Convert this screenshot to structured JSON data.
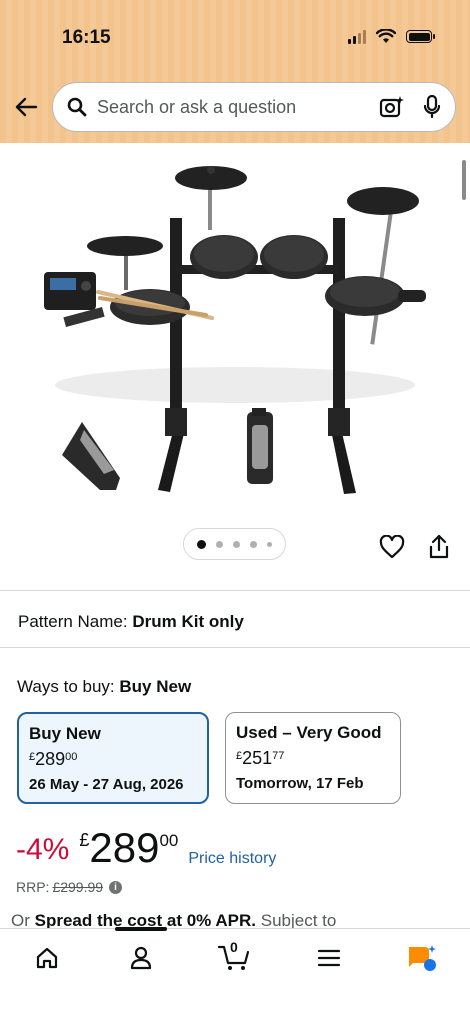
{
  "status_bar": {
    "time": "16:15"
  },
  "search": {
    "placeholder": "Search or ask a question"
  },
  "pattern": {
    "label": "Pattern Name:",
    "value": "Drum Kit only"
  },
  "ways_to_buy": {
    "label": "Ways to buy:",
    "value": "Buy New"
  },
  "options": [
    {
      "title": "Buy New",
      "currency": "£",
      "whole": "289",
      "fraction": "00",
      "delivery": "26 May - 27 Aug, 2026"
    },
    {
      "title": "Used – Very Good",
      "currency": "£",
      "whole": "251",
      "fraction": "77",
      "delivery": "Tomorrow, 17 Feb"
    }
  ],
  "price": {
    "discount": "-4%",
    "currency": "£",
    "whole": "289",
    "fraction": "00",
    "history_link": "Price history"
  },
  "rrp": {
    "label": "RRP:",
    "value": "£299.99"
  },
  "spread": {
    "prefix": "Or",
    "bold": "Spread the cost at 0% APR.",
    "suffix": "Subject to"
  },
  "cart": {
    "count": "0"
  },
  "icons": [
    "back-arrow-icon",
    "search-icon",
    "camera-sparkle-icon",
    "microphone-icon",
    "heart-icon",
    "share-icon",
    "home-icon",
    "account-icon",
    "cart-icon",
    "menu-icon",
    "rufus-ai-icon"
  ],
  "colors": {
    "header": "#f2c38c",
    "selected_border": "#2162a1",
    "discount": "#cc0c39",
    "link": "#2162a1",
    "ai_orange": "#ff8c00",
    "ai_blue": "#1a73e8"
  },
  "gallery": {
    "dot_count": 5,
    "active_index": 0
  }
}
